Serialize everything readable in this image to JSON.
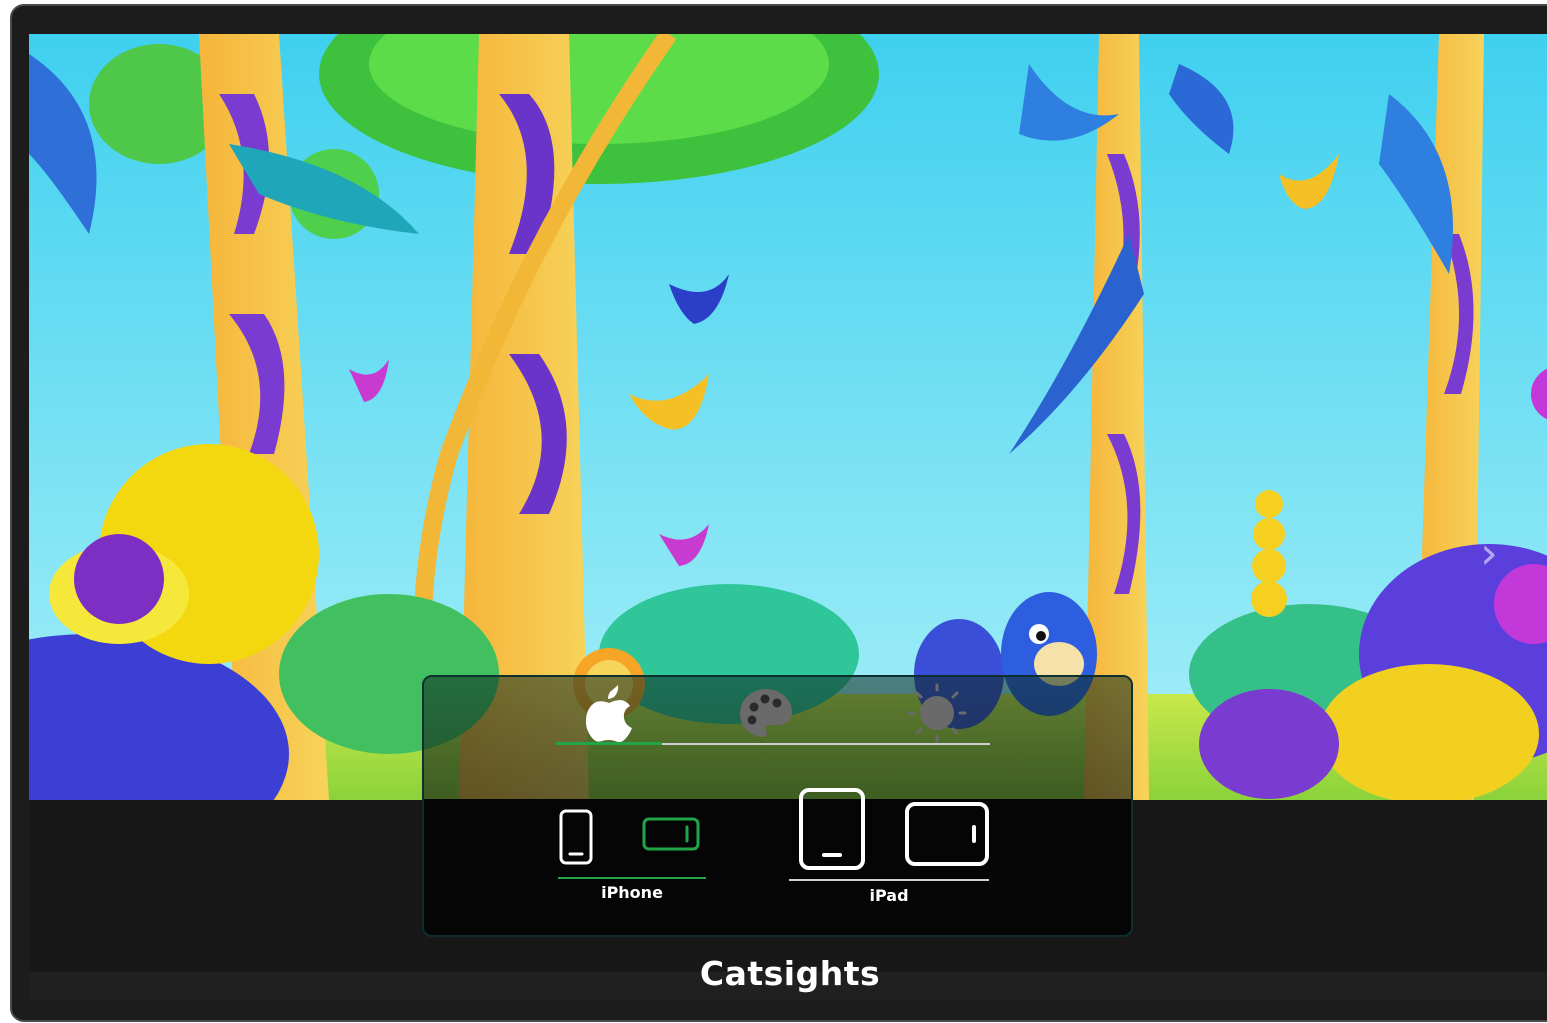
{
  "app": {
    "brand": "Catsights"
  },
  "colors": {
    "accent": "#22a548",
    "panel_bg": "#050505",
    "bottom_bar": "#202020"
  },
  "scene": {
    "description_icon": "forest-illustration"
  },
  "settings_panel": {
    "tabs": [
      {
        "name": "apple",
        "icon": "apple-icon",
        "active": true
      },
      {
        "name": "palette",
        "icon": "palette-icon",
        "active": false
      },
      {
        "name": "brightness",
        "icon": "brightness-icon",
        "active": false
      }
    ],
    "device_groups": [
      {
        "label": "iPhone",
        "active": true,
        "devices": [
          {
            "icon": "phone-portrait-icon",
            "selected": false
          },
          {
            "icon": "phone-landscape-icon",
            "selected": true
          }
        ]
      },
      {
        "label": "iPad",
        "active": false,
        "devices": [
          {
            "icon": "tablet-portrait-icon",
            "selected": false
          },
          {
            "icon": "tablet-landscape-icon",
            "selected": false
          }
        ]
      }
    ]
  },
  "carousel": {
    "next_icon": "chevron-right-icon"
  }
}
